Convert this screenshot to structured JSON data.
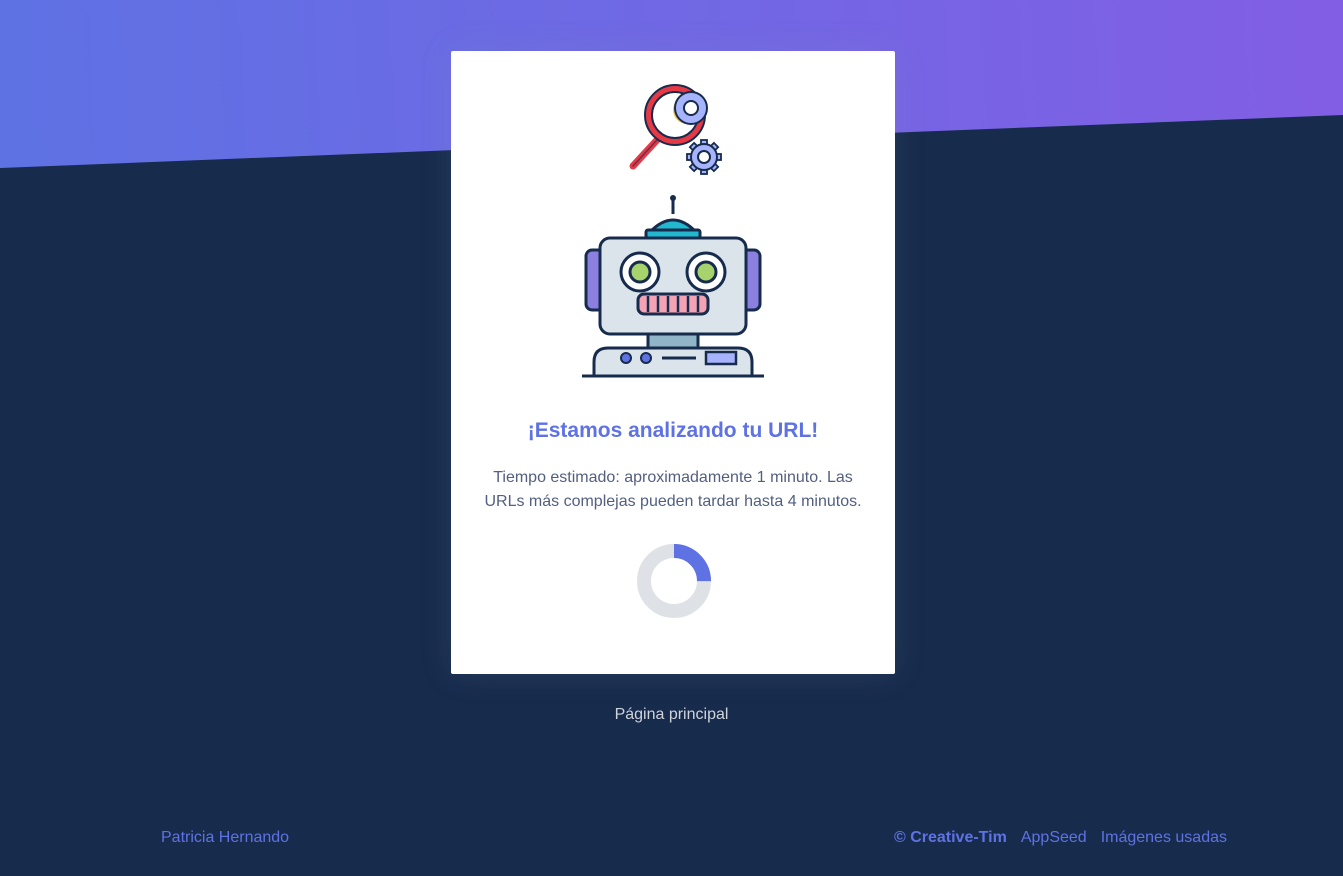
{
  "card": {
    "title": "¡Estamos analizando tu URL!",
    "description": "Tiempo estimado: aproximadamente 1 minuto. Las URLs más complejas pueden tardar hasta 4 minutos.",
    "icons": [
      "magnifier-gear-icon",
      "robot-icon"
    ],
    "loading_progress": 0.25
  },
  "nav": {
    "home_link": "Página principal"
  },
  "footer": {
    "author": "Patricia Hernando",
    "copyright": "© Creative-Tim",
    "appseed": "AppSeed",
    "images": "Imágenes usadas"
  },
  "colors": {
    "accent": "#5e72e4",
    "gradient_end": "#825ee4",
    "background": "#172b4d"
  }
}
